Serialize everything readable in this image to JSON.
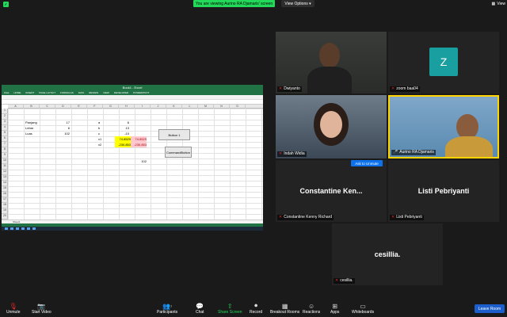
{
  "top_bar": {
    "banner": "You are viewing Aurino RA Djamaris' screen",
    "view_options": "View Options",
    "view": "View"
  },
  "excel": {
    "title": "Book1 - Excel",
    "tabs": [
      "FILE",
      "HOME",
      "INSERT",
      "PAGE LAYOUT",
      "FORMULAS",
      "DATA",
      "REVIEW",
      "VIEW",
      "DEVELOPER",
      "POWERPIVOT"
    ],
    "columns": [
      "A",
      "B",
      "C",
      "D",
      "E",
      "F",
      "G",
      "H",
      "I",
      "J",
      "K",
      "L",
      "M",
      "N",
      "O"
    ],
    "rows": [
      "1",
      "2",
      "3",
      "4",
      "5",
      "6",
      "7",
      "8",
      "9",
      "10",
      "11",
      "12",
      "13",
      "14",
      "15",
      "16",
      "17",
      "18",
      "19",
      "20"
    ],
    "cells": {
      "panjang_label": "Panjang",
      "panjang_val": "17",
      "lebar_label": "Lebar",
      "lebar_val": "6",
      "luas_label": "Luas",
      "luas_val": "102",
      "a_label": "a",
      "a_val": "6",
      "b_label": "b",
      "b_val": "13",
      "c_label": "c",
      "c_val": "-10",
      "x1_label": "x1",
      "x1_val": "74.8529",
      "x1_val2": "74.8529",
      "x2_label": "x2",
      "x2_val": "-230.853",
      "x2_val2": "-230.853",
      "h11": "102"
    },
    "button1": "Button 1",
    "command_button": "CommandButton",
    "sheet_tab": "Sheet1"
  },
  "participants": {
    "dwiyanto": "Dwiyanto",
    "zoom": "zoom baa04",
    "zoom_initial": "Z",
    "indah": "Indah Widia",
    "aurino": "Aurino RA Djamaris",
    "constantine_big": "Constantine  Ken...",
    "constantine": "Constantine Kenny Richard",
    "ask_unmute": "Ask to Unmute",
    "listi_big": "Listi Pebriyanti",
    "listi": "Listi Pebriyanti",
    "cesillia_big": "cesillia.",
    "cesillia": "cesillia."
  },
  "toolbar": {
    "unmute": "Unmute",
    "start_video": "Start Video",
    "participants": "Participants",
    "participants_count": "7",
    "chat": "Chat",
    "share_screen": "Share Screen",
    "record": "Record",
    "breakout_rooms": "Breakout Rooms",
    "reactions": "Reactions",
    "apps": "Apps",
    "whiteboards": "Whiteboards",
    "leave": "Leave Room"
  },
  "colors": {
    "zoom_green": "#23d959",
    "avatar_teal": "#1a9fa0",
    "active_speaker": "#ffd400",
    "leave_blue": "#1c5fcc",
    "excel_green": "#217346"
  }
}
